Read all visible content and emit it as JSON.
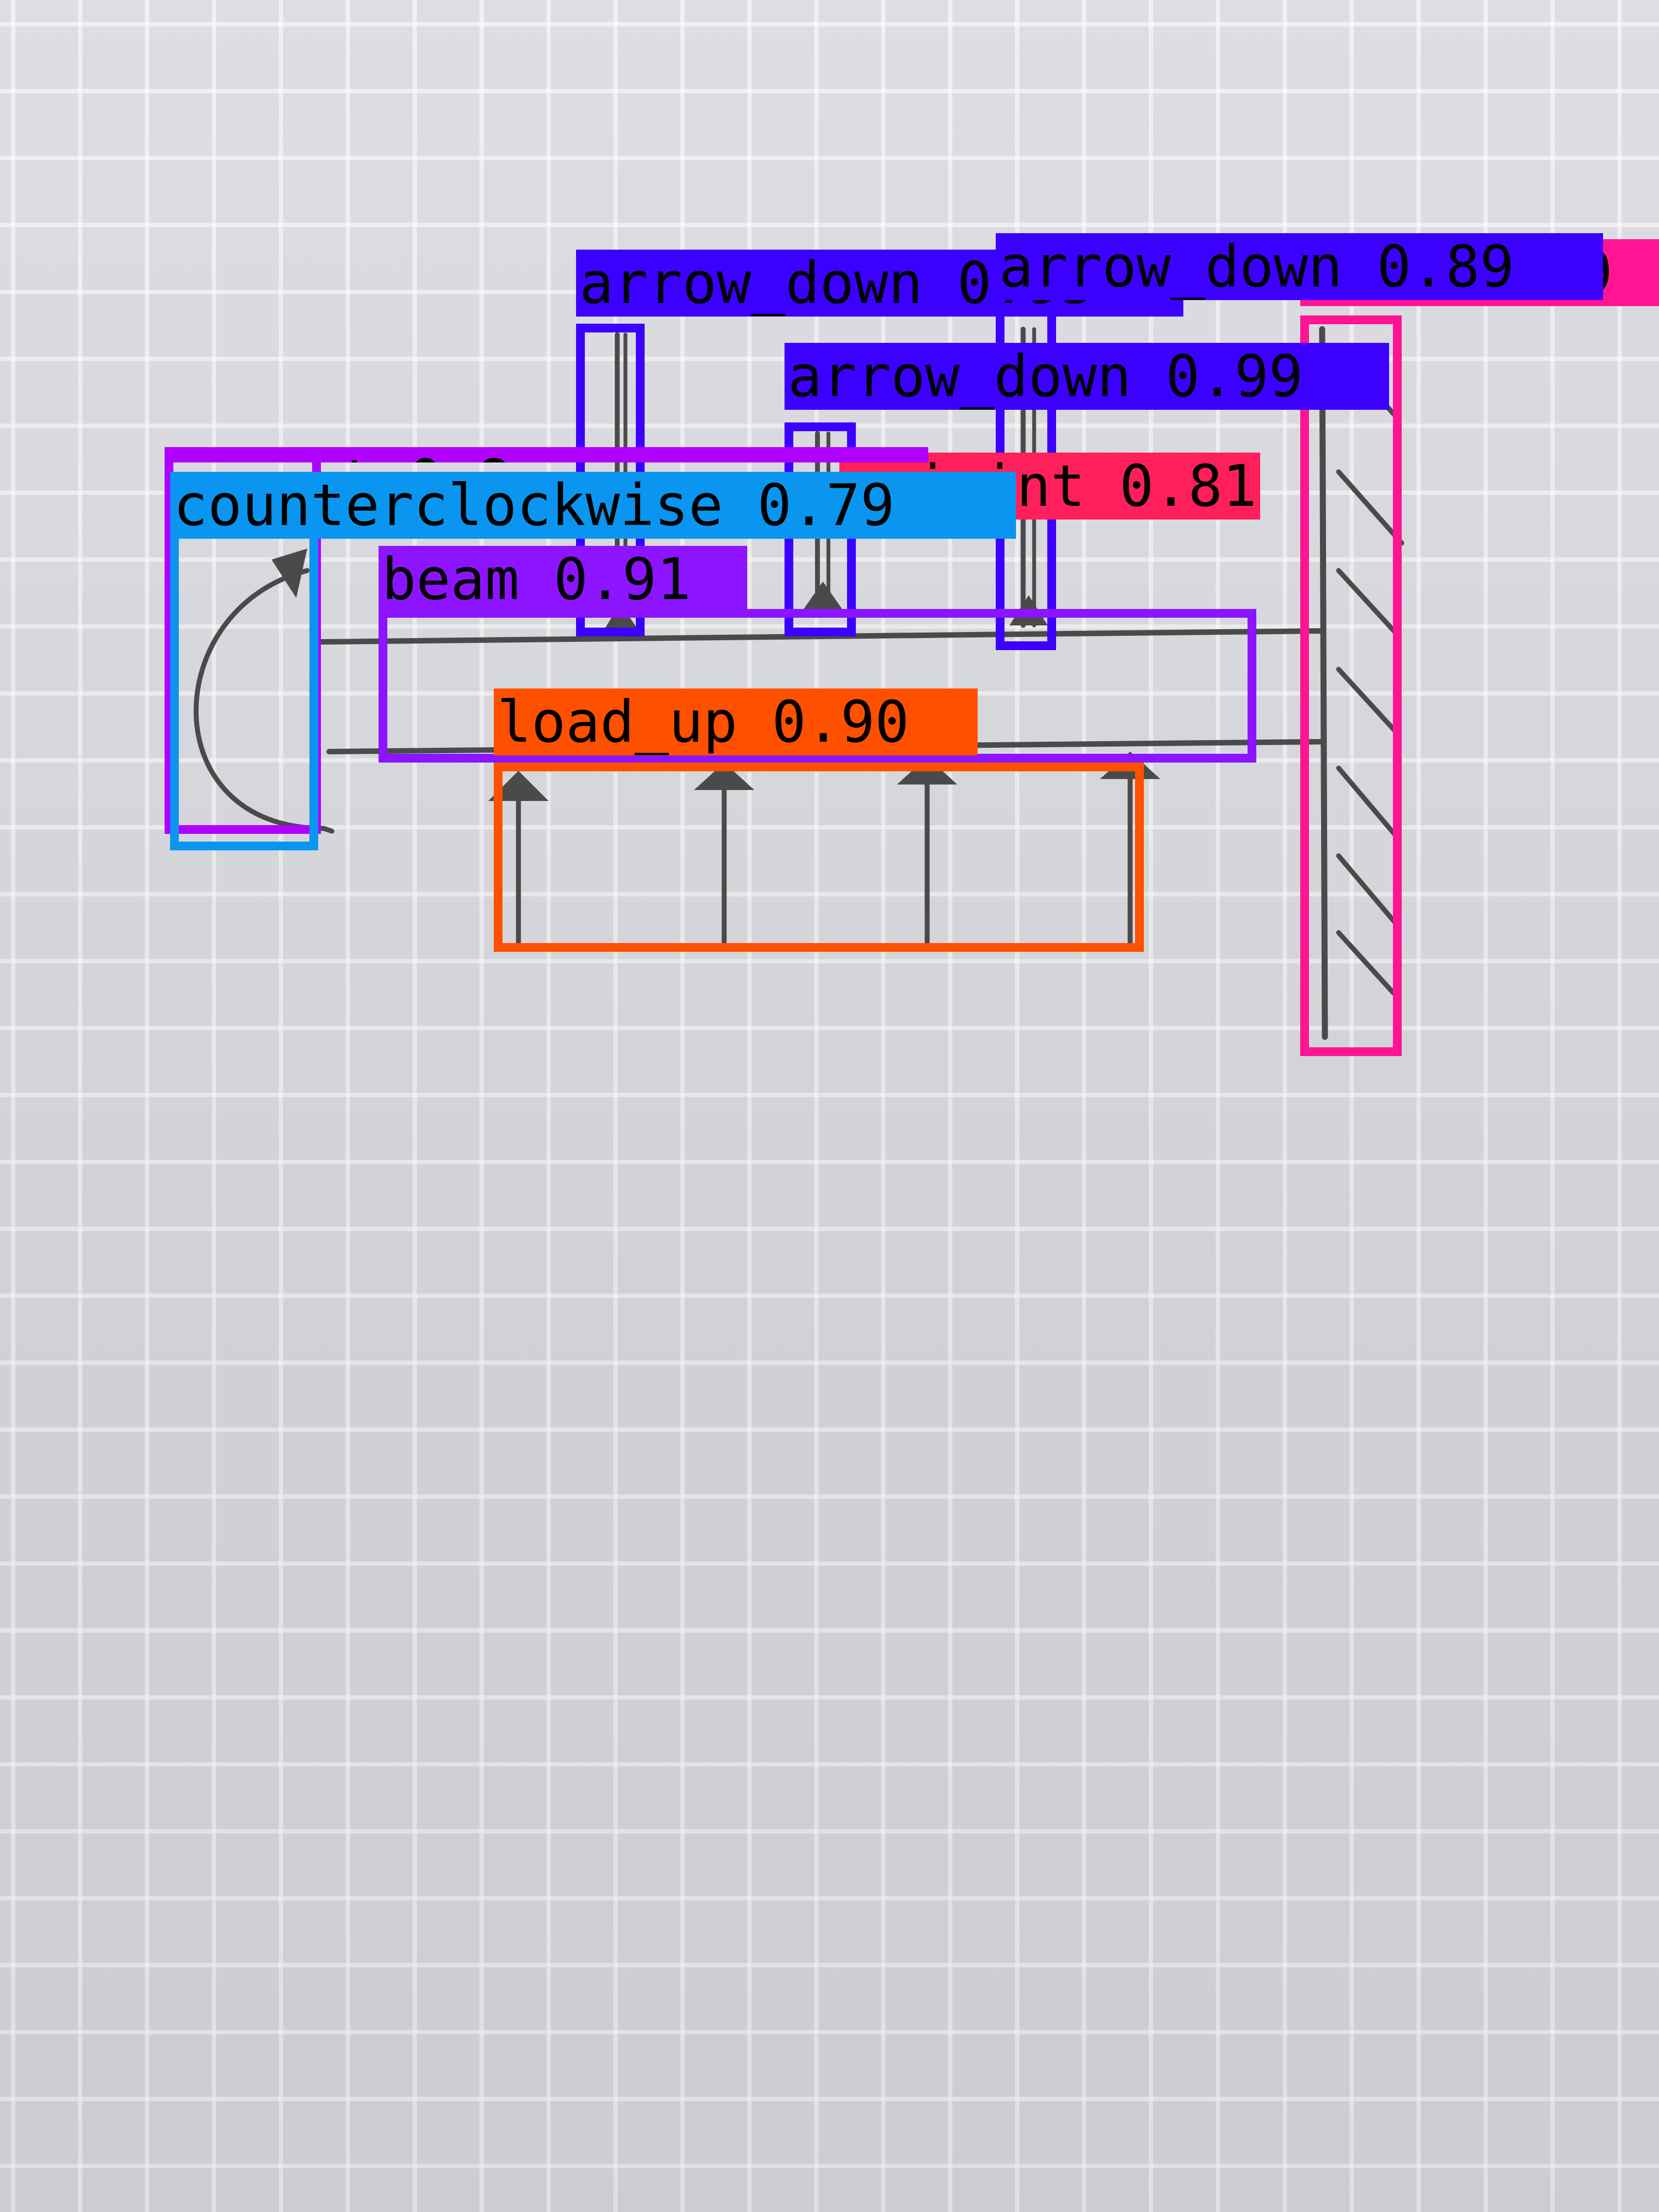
{
  "scene": {
    "description_free": true,
    "background": "#d9dadf",
    "ink": "#4a4a4a"
  },
  "detections": [
    {
      "id": "fixed-support",
      "label": "fixed 0.9",
      "color": "#ff1493"
    },
    {
      "id": "joint",
      "label": "joint 0.81",
      "color": "#ff1f5a"
    },
    {
      "id": "moment",
      "label": "moment 0.8",
      "color": "#b000ff"
    },
    {
      "id": "arrow-1",
      "label": "arrow_down 0.95",
      "color": "#3c00ff"
    },
    {
      "id": "arrow-2",
      "label": "arrow_down 0.99",
      "color": "#3c00ff"
    },
    {
      "id": "arrow-3",
      "label": "arrow_down 0.89",
      "color": "#3c00ff"
    },
    {
      "id": "counterclockwise",
      "label": "counterclockwise 0.79",
      "color": "#0a96f0"
    },
    {
      "id": "beam",
      "label": "beam 0.91",
      "color": "#8c14ff"
    },
    {
      "id": "load-up",
      "label": "load_up 0.90",
      "color": "#ff5000"
    }
  ]
}
